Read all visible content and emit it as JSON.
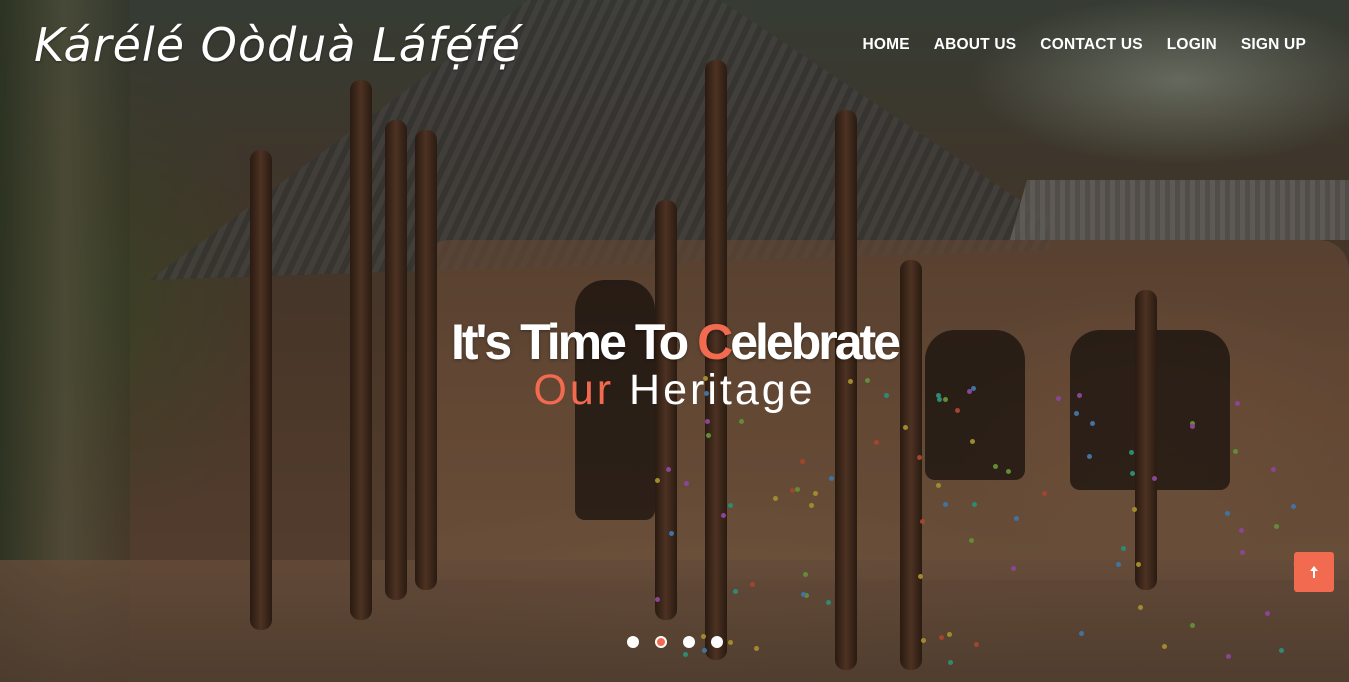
{
  "site": {
    "logo_text": "Kárélé  Oòduà Láfẹ́fẹ́"
  },
  "nav": {
    "items": [
      {
        "label": "HOME"
      },
      {
        "label": "ABOUT US"
      },
      {
        "label": "CONTACT US"
      },
      {
        "label": "LOGIN"
      },
      {
        "label": "SIGN UP"
      }
    ]
  },
  "hero": {
    "headline_part1": "It's Time To ",
    "headline_accent": "C",
    "headline_part2": "elebrate",
    "subline_accent": "Our",
    "subline_rest": " Heritage"
  },
  "carousel": {
    "slide_count": 4,
    "active_index": 1
  },
  "colors": {
    "accent": "#f26a50",
    "text": "#ffffff"
  },
  "icons": {
    "scroll_top": "arrow-up-icon"
  }
}
